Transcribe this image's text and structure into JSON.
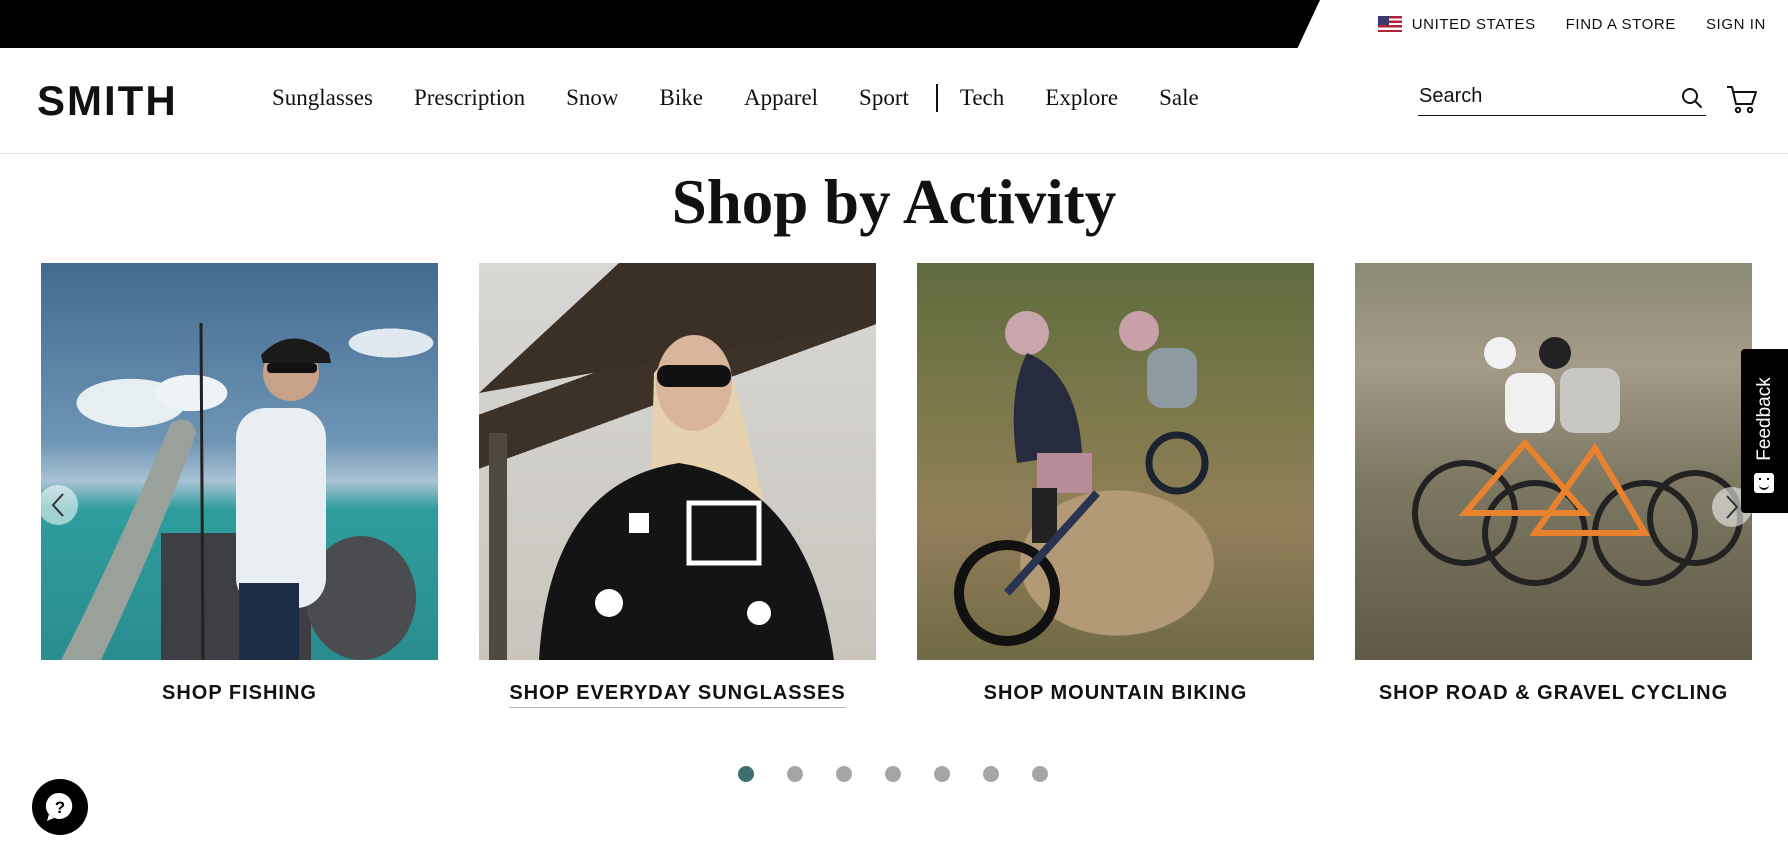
{
  "utility_bar": {
    "country": "UNITED STATES",
    "find_store": "FIND A STORE",
    "sign_in": "SIGN IN"
  },
  "header": {
    "logo": "SMITH",
    "nav": [
      "Sunglasses",
      "Prescription",
      "Snow",
      "Bike",
      "Apparel",
      "Sport",
      "Tech",
      "Explore",
      "Sale"
    ],
    "search_placeholder": "Search"
  },
  "section": {
    "title": "Shop by Activity",
    "cards": [
      {
        "label": "SHOP FISHING"
      },
      {
        "label": "SHOP EVERYDAY SUNGLASSES"
      },
      {
        "label": "SHOP MOUNTAIN BIKING"
      },
      {
        "label": "SHOP ROAD & GRAVEL CYCLING"
      }
    ]
  },
  "carousel": {
    "dot_count": 7,
    "active_dot": 1
  },
  "feedback": {
    "label": "Feedback"
  },
  "colors": {
    "active_dot": "#3f6f70",
    "inactive_dot": "#a5a5a5",
    "utility_bar": "#000000"
  }
}
